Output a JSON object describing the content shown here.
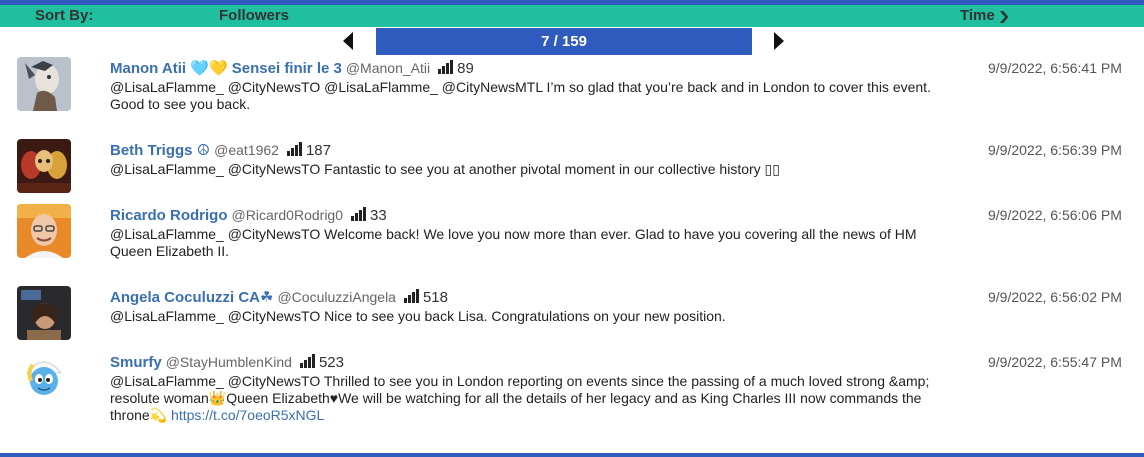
{
  "sort": {
    "label": "Sort By:",
    "followers_label": "Followers",
    "time_label": "Time",
    "time_icon": "chevron-down"
  },
  "pager": {
    "page_text": "7 / 159"
  },
  "colors": {
    "accent_blue": "#2e5bbd",
    "sortbar_teal": "#1fbf9f",
    "name_blue": "#3a6fb0"
  },
  "tweets": [
    {
      "name": "Manon Atii 🩵💛 Sensei finir le 3",
      "handle": "@Manon_Atii",
      "followers": "89",
      "text": "@LisaLaFlamme_ @CityNewsTO @LisaLaFlamme_ @CityNewsMTL I’m so glad that you’re back and in London to cover this event. Good to see you back.",
      "time": "9/9/2022, 6:56:41 PM"
    },
    {
      "name": "Beth Triggs ☮",
      "handle": "@eat1962",
      "followers": "187",
      "text": "@LisaLaFlamme_ @CityNewsTO Fantastic to see you at another pivotal moment in our collective history ▯▯",
      "time": "9/9/2022, 6:56:39 PM"
    },
    {
      "name": "Ricardo Rodrigo",
      "handle": "@Ricard0Rodrig0",
      "followers": "33",
      "text": "@LisaLaFlamme_ @CityNewsTO Welcome back! We love you now more than ever. Glad to have you covering all the news of HM Queen Elizabeth II.",
      "time": "9/9/2022, 6:56:06 PM"
    },
    {
      "name": "Angela Coculuzzi CA☘",
      "handle": "@CoculuzziAngela",
      "followers": "518",
      "text": "@LisaLaFlamme_ @CityNewsTO Nice to see you back Lisa. Congratulations on your new position.",
      "time": "9/9/2022, 6:56:02 PM"
    },
    {
      "name": "Smurfy",
      "handle": "@StayHumblenKind",
      "followers": "523",
      "text": "@LisaLaFlamme_ @CityNewsTO Thrilled to see you in London reporting on events since the passing of a much loved strong &amp; resolute woman👑Queen Elizabeth♥We will be watching for all the details of her legacy and as King Charles III now commands the throne💫",
      "link": "https://t.co/7oeoR5xNGL",
      "time": "9/9/2022, 6:55:47 PM"
    }
  ]
}
